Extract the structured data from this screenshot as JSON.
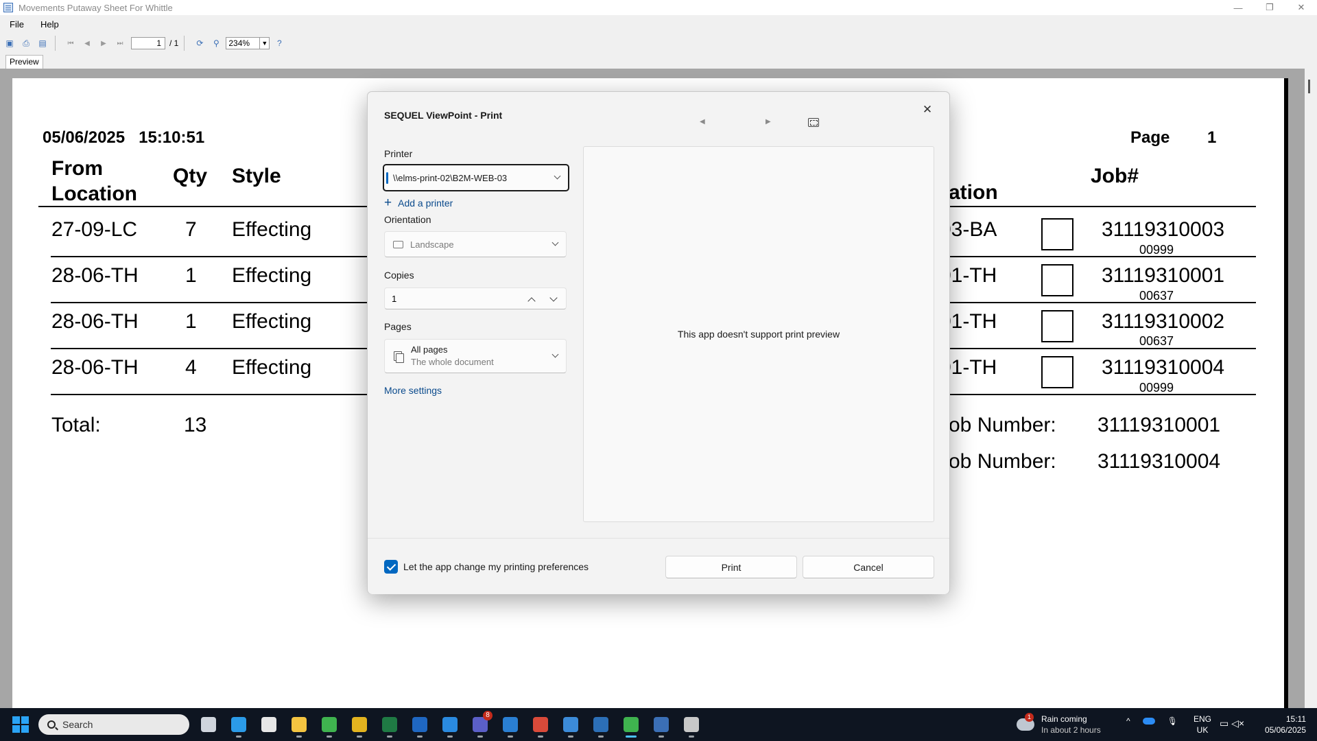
{
  "window": {
    "title": "Movements Putaway Sheet For Whittle",
    "minimize": "—",
    "restore": "❐",
    "close": "✕"
  },
  "menu": {
    "file": "File",
    "help": "Help"
  },
  "toolbar": {
    "page_value": "1",
    "page_total": "/ 1",
    "zoom": "234%"
  },
  "tabs": {
    "preview": "Preview"
  },
  "report": {
    "datetime": "05/06/2025   15:10:51",
    "page_label": "Page",
    "page_number": "1",
    "headers": {
      "from_location": "From\nLocation",
      "qty": "Qty",
      "style": "Style",
      "to_location_partial": "ation",
      "job": "Job#"
    },
    "rows": [
      {
        "from": "27-09-LC",
        "qty": "7",
        "style": "Effecting",
        "to": "03-BA",
        "job": "31119310003",
        "sub": "00999"
      },
      {
        "from": "28-06-TH",
        "qty": "1",
        "style": "Effecting",
        "to": "01-TH",
        "job": "31119310001",
        "sub": "00637"
      },
      {
        "from": "28-06-TH",
        "qty": "1",
        "style": "Effecting",
        "to": "01-TH",
        "job": "31119310002",
        "sub": "00637"
      },
      {
        "from": "28-06-TH",
        "qty": "4",
        "style": "Effecting",
        "to": "01-TH",
        "job": "31119310004",
        "sub": "00999"
      }
    ],
    "total_label": "Total:",
    "total_value": "13",
    "job_lines": [
      {
        "label": "Job Number:",
        "value": "31119310001"
      },
      {
        "label": "Job Number:",
        "value": "31119310004"
      }
    ]
  },
  "dialog": {
    "title": "SEQUEL ViewPoint - Print",
    "close": "✕",
    "printer_label": "Printer",
    "printer_value": "\\\\elms-print-02\\B2M-WEB-03",
    "add_printer": "Add a printer",
    "orientation_label": "Orientation",
    "orientation_value": "Landscape",
    "copies_label": "Copies",
    "copies_value": "1",
    "pages_label": "Pages",
    "pages_value": "All pages",
    "pages_sub": "The whole document",
    "more_settings": "More settings",
    "preview_message": "This app doesn't support print preview",
    "checkbox_label": "Let the app change my printing preferences",
    "checkbox_checked": true,
    "print_button": "Print",
    "cancel_button": "Cancel"
  },
  "taskbar": {
    "search_placeholder": "Search",
    "apps": [
      {
        "name": "task-view",
        "color": "#cfd5dd"
      },
      {
        "name": "edge",
        "color": "#2b9be8"
      },
      {
        "name": "store",
        "color": "#e7e7e7"
      },
      {
        "name": "file-explorer",
        "color": "#f4c441"
      },
      {
        "name": "search-app",
        "color": "#3fb34f"
      },
      {
        "name": "chrome",
        "color": "#e3b31f"
      },
      {
        "name": "excel",
        "color": "#1f7a44"
      },
      {
        "name": "outlook",
        "color": "#1f67c2"
      },
      {
        "name": "app-blue",
        "color": "#2a8ae0"
      },
      {
        "name": "teams",
        "color": "#5b5fc7"
      },
      {
        "name": "photos",
        "color": "#2a7fd3"
      },
      {
        "name": "snipping",
        "color": "#d94a3a"
      },
      {
        "name": "notepad",
        "color": "#3c8bd9"
      },
      {
        "name": "app-search",
        "color": "#2c6fb7"
      },
      {
        "name": "viewpoint",
        "color": "#3fb34f"
      },
      {
        "name": "remote",
        "color": "#3b6fb6"
      },
      {
        "name": "app-grey",
        "color": "#c8c8c8"
      }
    ],
    "teams_badge": "8",
    "weather_badge": "1",
    "weather_title": "Rain coming",
    "weather_sub": "In about 2 hours",
    "chevron": "^",
    "lang_top": "ENG",
    "lang_bottom": "UK",
    "sys_icons": "▭  ◁×",
    "time": "15:11",
    "date": "05/06/2025"
  }
}
